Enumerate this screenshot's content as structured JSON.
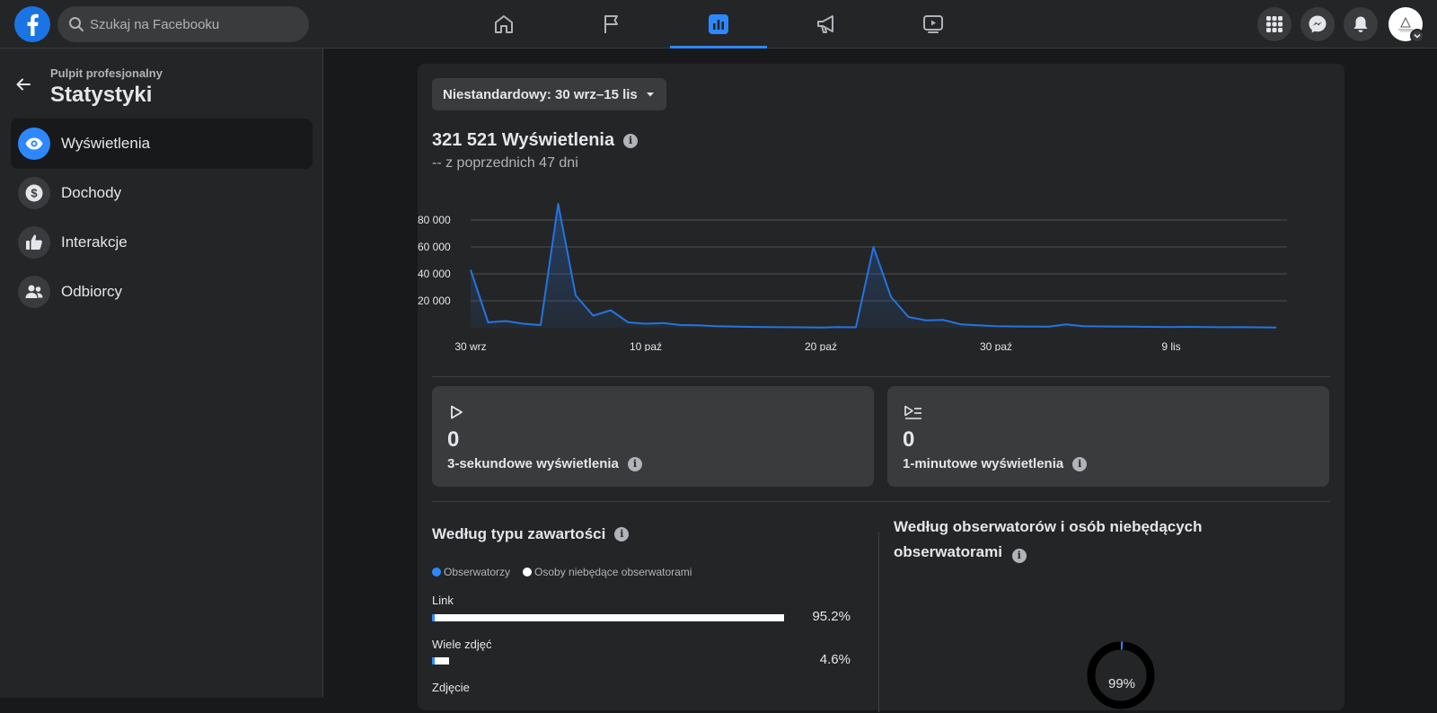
{
  "topbar": {
    "search_placeholder": "Szukaj na Facebooku",
    "nav_tabs": [
      "home-icon",
      "flag-icon",
      "insights-icon",
      "megaphone-icon",
      "video-icon"
    ],
    "active_tab": "insights-icon",
    "right_buttons": [
      "menu-grid-icon",
      "messenger-icon",
      "bell-icon"
    ]
  },
  "sidebar": {
    "subtitle": "Pulpit profesjonalny",
    "title": "Statystyki",
    "items": [
      {
        "label": "Wyświetlenia",
        "icon": "eye-icon",
        "active": true
      },
      {
        "label": "Dochody",
        "icon": "dollar-icon",
        "active": false
      },
      {
        "label": "Interakcje",
        "icon": "thumbs-up-icon",
        "active": false
      },
      {
        "label": "Odbiorcy",
        "icon": "people-icon",
        "active": false
      }
    ]
  },
  "main": {
    "range_label": "Niestandardowy: 30 wrz–15 lis",
    "views_title": "321 521 Wyświetlenia",
    "views_sub": "-- z poprzednich 47 dni",
    "metrics": [
      {
        "value": "0",
        "label": "3-sekundowe wyświetlenia",
        "icon": "play-icon"
      },
      {
        "value": "0",
        "label": "1-minutowe wyświetlenia",
        "icon": "play-list-icon"
      }
    ],
    "content_type": {
      "title": "Według typu zawartości",
      "legend": [
        "Obserwatorzy",
        "Osoby niebędące obserwatorami"
      ],
      "rows": [
        {
          "label": "Link",
          "pct_text": "95.2%",
          "pct": 95.2
        },
        {
          "label": "Wiele zdjęć",
          "pct_text": "4.6%",
          "pct": 4.6
        },
        {
          "label": "Zdjęcie",
          "pct_text": "",
          "pct": 0.2
        }
      ]
    },
    "followers": {
      "title": "Według obserwatorów i osób niebędących obserwatorami",
      "non_follower_share": 0.99,
      "follower_share": 0.01,
      "pct_text": "99%"
    }
  },
  "colors": {
    "accent": "#2d88ff",
    "bg": "#18191a",
    "surface": "#242526",
    "surface2": "#3a3b3c",
    "line": "#2374e1"
  },
  "chart_data": {
    "type": "area",
    "title": "",
    "xlabel": "",
    "ylabel": "",
    "ylim": [
      0,
      95000
    ],
    "yticks": [
      20000,
      40000,
      60000,
      80000
    ],
    "ytick_labels": [
      "20 000",
      "40 000",
      "60 000",
      "80 000"
    ],
    "xtick_labels": [
      "30 wrz",
      "10 paź",
      "20 paź",
      "30 paź",
      "9 lis"
    ],
    "x": [
      "30 wrz",
      "1 paź",
      "2 paź",
      "3 paź",
      "4 paź",
      "5 paź",
      "6 paź",
      "7 paź",
      "8 paź",
      "9 paź",
      "10 paź",
      "11 paź",
      "12 paź",
      "13 paź",
      "14 paź",
      "15 paź",
      "16 paź",
      "17 paź",
      "18 paź",
      "19 paź",
      "20 paź",
      "21 paź",
      "22 paź",
      "23 paź",
      "24 paź",
      "25 paź",
      "26 paź",
      "27 paź",
      "28 paź",
      "29 paź",
      "30 paź",
      "31 paź",
      "1 lis",
      "2 lis",
      "3 lis",
      "4 lis",
      "5 lis",
      "6 lis",
      "7 lis",
      "8 lis",
      "9 lis",
      "10 lis",
      "11 lis",
      "12 lis",
      "13 lis",
      "14 lis",
      "15 lis"
    ],
    "series": [
      {
        "name": "",
        "values": [
          43000,
          4000,
          5000,
          3000,
          2000,
          92000,
          24000,
          9000,
          13000,
          4000,
          3000,
          3500,
          2000,
          1800,
          1200,
          900,
          700,
          500,
          400,
          300,
          200,
          500,
          300,
          60000,
          23000,
          8000,
          5500,
          5800,
          2500,
          1800,
          1200,
          1000,
          900,
          800,
          2500,
          1200,
          1000,
          900,
          800,
          700,
          500,
          700,
          500,
          400,
          500,
          300,
          200
        ]
      }
    ]
  }
}
